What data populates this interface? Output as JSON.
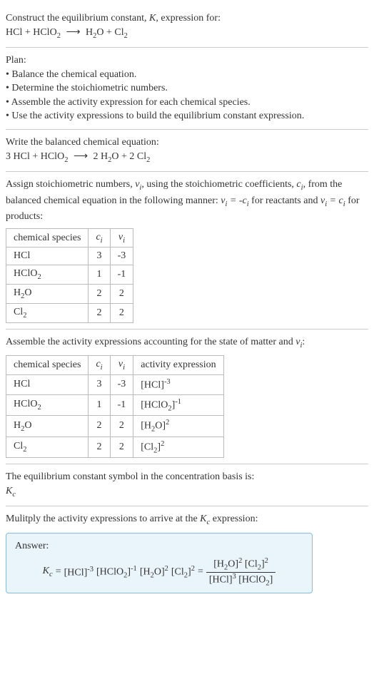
{
  "intro": {
    "line1_a": "Construct the equilibrium constant, ",
    "line1_b": ", expression for:",
    "eq_lhs1": "HCl + HClO",
    "eq_arrow": "⟶",
    "eq_rhs1": "H",
    "eq_rhs2": "O + Cl"
  },
  "plan": {
    "title": "Plan:",
    "b1": "• Balance the chemical equation.",
    "b2": "• Determine the stoichiometric numbers.",
    "b3": "• Assemble the activity expression for each chemical species.",
    "b4": "• Use the activity expressions to build the equilibrium constant expression."
  },
  "balanced": {
    "title": "Write the balanced chemical equation:",
    "lhs": "3 HCl + HClO",
    "arrow": "⟶",
    "rhs1": "2 H",
    "rhs2": "O + 2 Cl"
  },
  "stoich": {
    "intro_a": "Assign stoichiometric numbers, ",
    "intro_b": ", using the stoichiometric coefficients, ",
    "intro_c": ", from the balanced chemical equation in the following manner: ",
    "intro_d": " for reactants and ",
    "intro_e": " for products:",
    "h_species": "chemical species",
    "r1_s": "HCl",
    "r1_c": "3",
    "r1_v": "-3",
    "r2_s": "HClO",
    "r2_c": "1",
    "r2_v": "-1",
    "r3_s": "H",
    "r3_s2": "O",
    "r3_c": "2",
    "r3_v": "2",
    "r4_s": "Cl",
    "r4_c": "2",
    "r4_v": "2"
  },
  "activity": {
    "intro_a": "Assemble the activity expressions accounting for the state of matter and ",
    "intro_b": ":",
    "h_species": "chemical species",
    "h_activity": "activity expression",
    "r1_s": "HCl",
    "r1_c": "3",
    "r1_v": "-3",
    "r1_a_base": "[HCl]",
    "r1_a_exp": "-3",
    "r2_s": "HClO",
    "r2_c": "1",
    "r2_v": "-1",
    "r2_a_base": "[HClO",
    "r2_a_exp": "-1",
    "r3_s": "H",
    "r3_s2": "O",
    "r3_c": "2",
    "r3_v": "2",
    "r3_a_base1": "[H",
    "r3_a_base2": "O]",
    "r3_a_exp": "2",
    "r4_s": "Cl",
    "r4_c": "2",
    "r4_v": "2",
    "r4_a_base": "[Cl",
    "r4_a_exp": "2"
  },
  "symbol": {
    "line": "The equilibrium constant symbol in the concentration basis is:"
  },
  "multiply": {
    "line_a": "Mulitply the activity expressions to arrive at the ",
    "line_b": " expression:"
  },
  "answer": {
    "label": "Answer:",
    "minus3": "-3",
    "minus1": "-1",
    "two": "2",
    "three": "3",
    "hcl": "[HCl]",
    "hclo": "[HClO",
    "h": "[H",
    "o_close": "O]",
    "cl": "[Cl",
    "close": "]",
    "eq": " = "
  }
}
